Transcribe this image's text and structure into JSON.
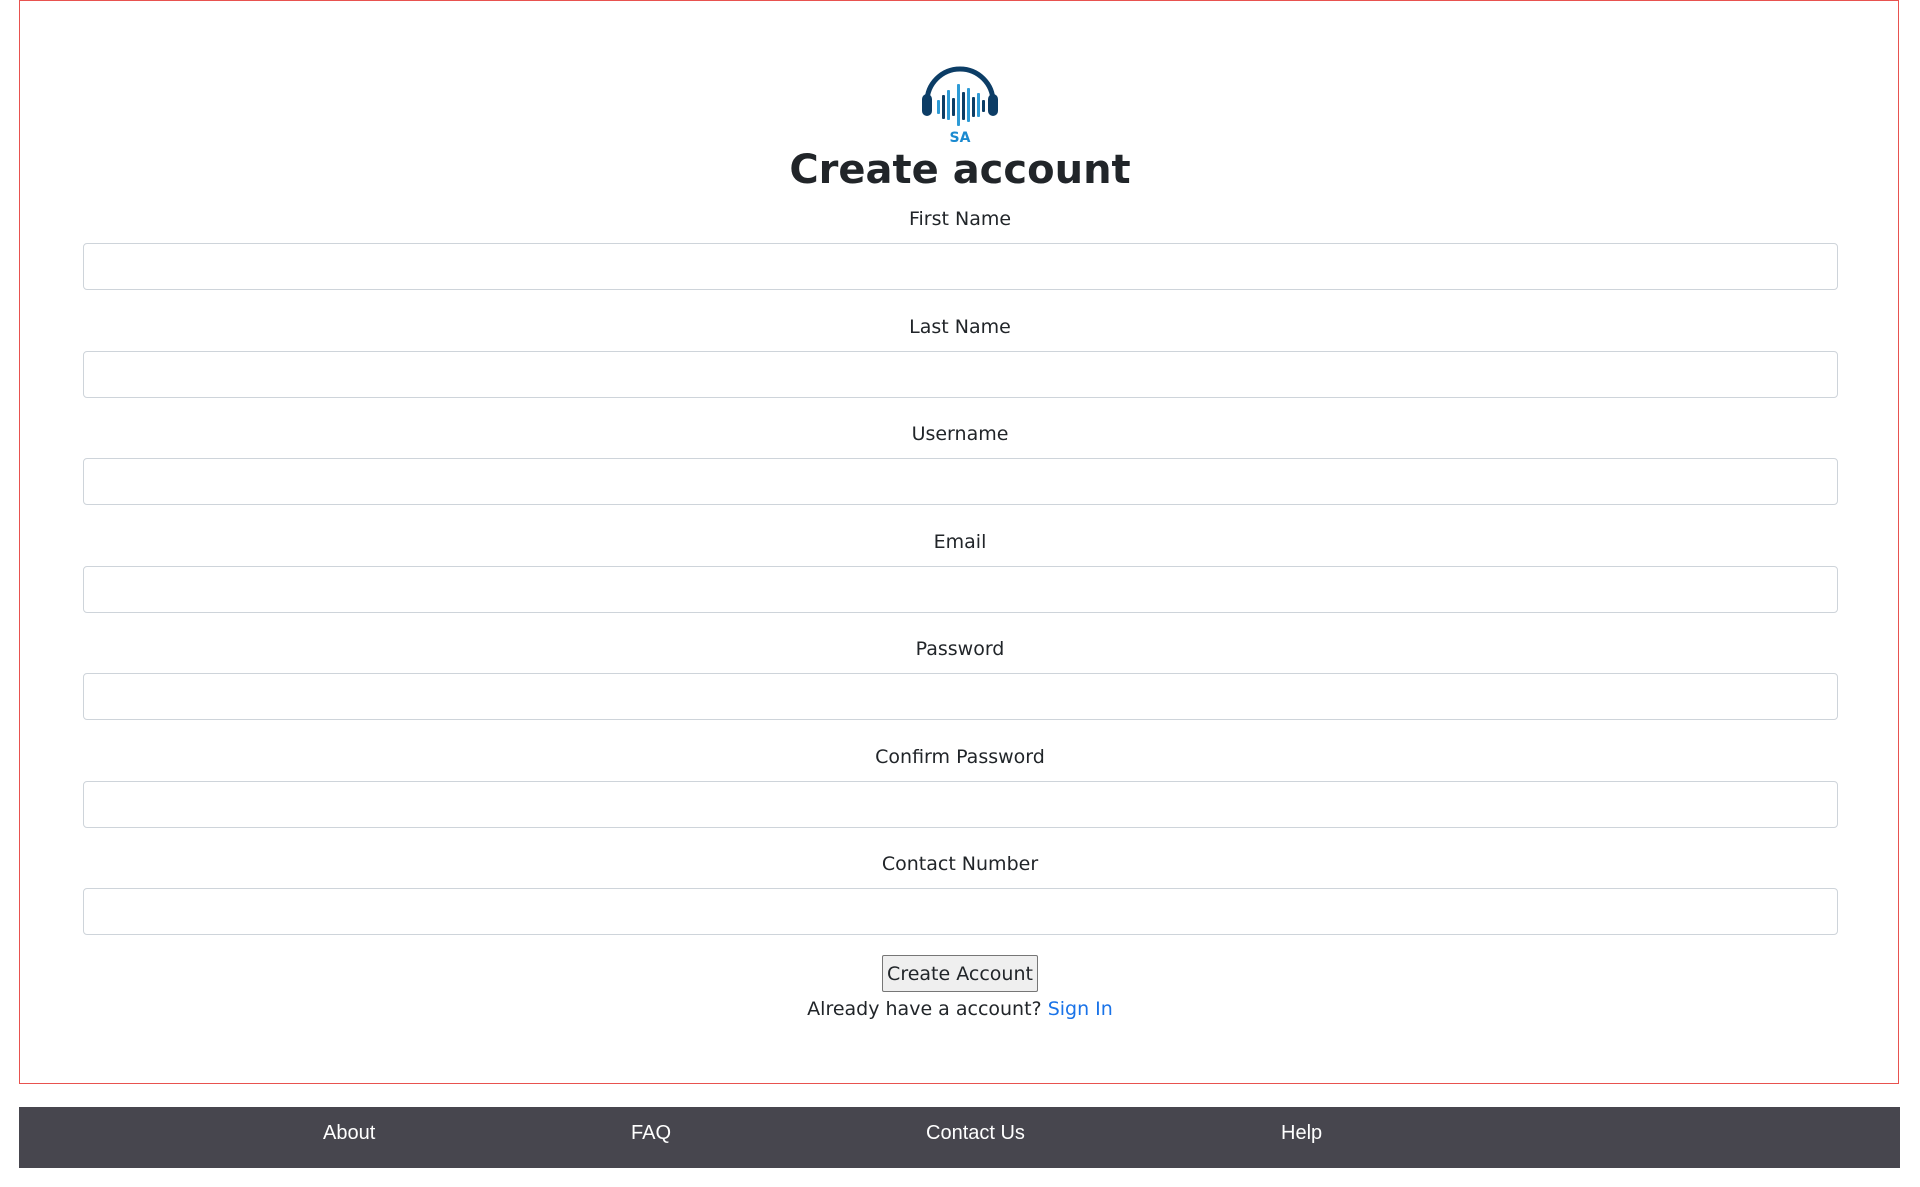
{
  "logo": {
    "icon": "headphones-soundwave-logo",
    "text": "SA",
    "colors": {
      "headband": "#0c3d66",
      "bars": "#2e9bd6",
      "text": "#1b8ad0"
    }
  },
  "title": "Create account",
  "fields": [
    {
      "id": "first_name",
      "label": "First Name",
      "value": "",
      "placeholder": ""
    },
    {
      "id": "last_name",
      "label": "Last Name",
      "value": "",
      "placeholder": ""
    },
    {
      "id": "username",
      "label": "Username",
      "value": "",
      "placeholder": ""
    },
    {
      "id": "email",
      "label": "Email",
      "value": "",
      "placeholder": ""
    },
    {
      "id": "password",
      "label": "Password",
      "value": "",
      "placeholder": ""
    },
    {
      "id": "confirm_password",
      "label": "Confirm Password",
      "value": "",
      "placeholder": ""
    },
    {
      "id": "contact_number",
      "label": "Contact Number",
      "value": "",
      "placeholder": ""
    }
  ],
  "submit_label": "Create Account",
  "signin": {
    "prompt": "Already have a account?",
    "link_label": "Sign In"
  },
  "footer": {
    "links": [
      "About",
      "FAQ",
      "Contact Us",
      "Help"
    ]
  },
  "colors": {
    "frame_border": "#e8524f",
    "footer_bg": "#47464e",
    "link": "#1a73e8"
  }
}
